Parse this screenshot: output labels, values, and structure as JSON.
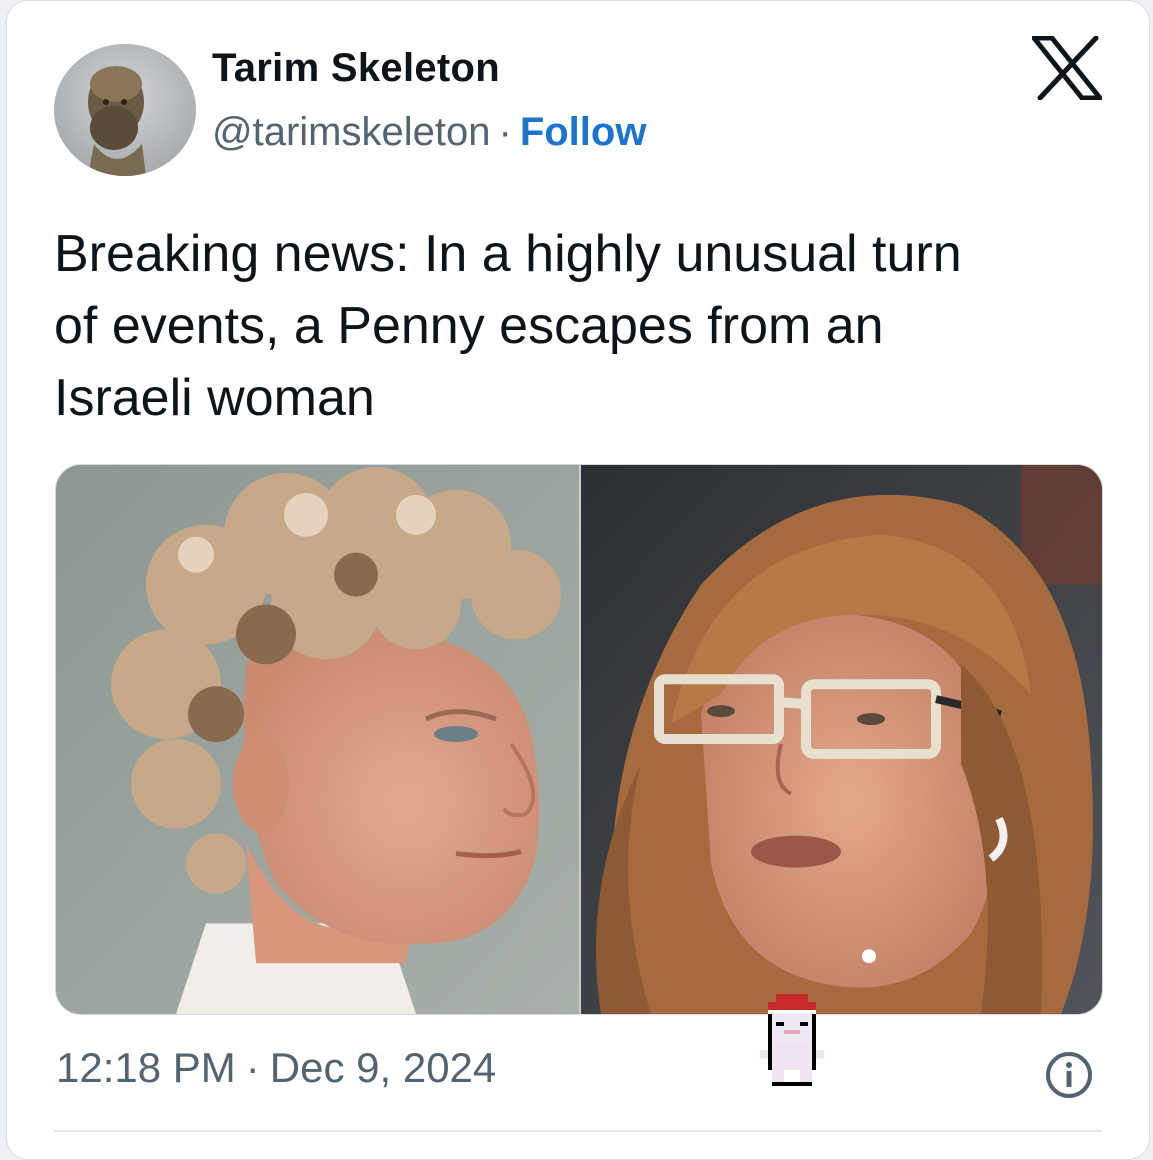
{
  "author": {
    "name": "Tarim Skeleton",
    "handle": "@tarimskeleton",
    "separator": "·",
    "follow_label": "Follow"
  },
  "platform": {
    "logo_icon": "x-logo-icon"
  },
  "tweet": {
    "text_line1": "Breaking news: In a highly unusual turn",
    "text_line2": "of events, a Penny escapes from an",
    "text_line3": "Israeli woman"
  },
  "media": {
    "photos": [
      {
        "icon": "man-portrait-photo"
      },
      {
        "icon": "woman-portrait-photo"
      }
    ]
  },
  "meta": {
    "time": "12:18 PM",
    "separator": "·",
    "date": "Dec 9, 2024",
    "info_icon": "info-icon"
  },
  "colors": {
    "follow": "#1d74cf",
    "text": "#0f1419",
    "muted": "#536471",
    "border": "#cfd9de"
  }
}
